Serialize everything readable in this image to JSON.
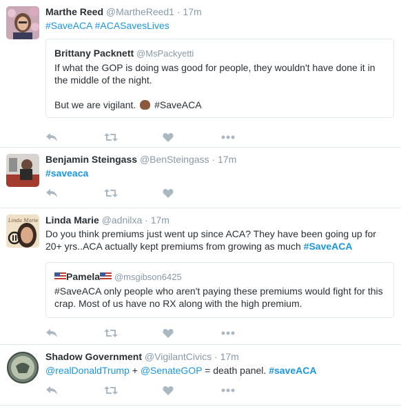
{
  "tweets": [
    {
      "name": "Marthe Reed",
      "handle": "@MartheReed1",
      "sep": "·",
      "time": "17m",
      "tags": [
        "#SaveACA",
        "#ACASavesLives"
      ],
      "quote": {
        "name": "Brittany Packnett",
        "handle": "@MsPackyetti",
        "line1": "If what the GOP is doing was good for people, they wouldn't have done it in the middle of the night.",
        "line2_prefix": "But we are vigilant.",
        "line2_tag": "#SaveACA"
      }
    },
    {
      "name": "Benjamin Steingass",
      "handle": "@BenSteingass",
      "sep": "·",
      "time": "17m",
      "tags": [
        "#saveaca"
      ]
    },
    {
      "name": "Linda Marie",
      "handle": "@adnilxa",
      "sep": "·",
      "time": "17m",
      "text": "Do you think premiums just went up since ACA? They have been going up for 20+ yrs..ACA actually kept premiums from growing as much",
      "text_tag": "#SaveACA",
      "avatar_text": "Linda Marie",
      "quote": {
        "name": "Pamela",
        "handle": "@msgibson6425",
        "text": "#SaveACA only people who aren't paying these premiums would fight for this crap. Most of us have no RX along with the high premium."
      }
    },
    {
      "name": "Shadow Government",
      "handle": "@VigilantCivics",
      "sep": "·",
      "time": "17m",
      "mention1": "@realDonaldTrump",
      "plus": "+",
      "mention2": "@SenateGOP",
      "mid": "= death panel.",
      "tag": "#saveACA"
    }
  ],
  "action_icons": [
    "reply-icon",
    "retweet-icon",
    "like-icon",
    "more-icon"
  ],
  "colors": {
    "link": "#1b95e0",
    "muted": "#8899a6",
    "text": "#292f33",
    "border": "#e1e8ed",
    "icon": "#aab8c2"
  }
}
